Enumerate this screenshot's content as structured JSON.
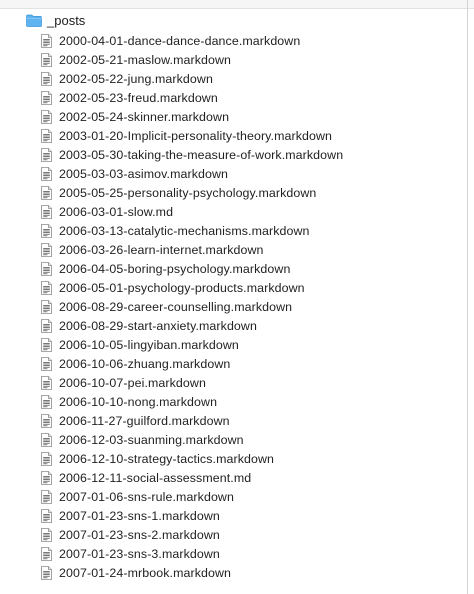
{
  "folder": {
    "name": "_posts",
    "icon": "folder-icon",
    "color": "#5fb3f0"
  },
  "files": [
    {
      "name": "2000-04-01-dance-dance-dance.markdown",
      "icon": "document-icon"
    },
    {
      "name": "2002-05-21-maslow.markdown",
      "icon": "document-icon"
    },
    {
      "name": "2002-05-22-jung.markdown",
      "icon": "document-icon"
    },
    {
      "name": "2002-05-23-freud.markdown",
      "icon": "document-icon"
    },
    {
      "name": "2002-05-24-skinner.markdown",
      "icon": "document-icon"
    },
    {
      "name": "2003-01-20-Implicit-personality-theory.markdown",
      "icon": "document-icon"
    },
    {
      "name": "2003-05-30-taking-the-measure-of-work.markdown",
      "icon": "document-icon"
    },
    {
      "name": "2005-03-03-asimov.markdown",
      "icon": "document-icon"
    },
    {
      "name": "2005-05-25-personality-psychology.markdown",
      "icon": "document-icon"
    },
    {
      "name": "2006-03-01-slow.md",
      "icon": "document-icon"
    },
    {
      "name": "2006-03-13-catalytic-mechanisms.markdown",
      "icon": "document-icon"
    },
    {
      "name": "2006-03-26-learn-internet.markdown",
      "icon": "document-icon"
    },
    {
      "name": "2006-04-05-boring-psychology.markdown",
      "icon": "document-icon"
    },
    {
      "name": "2006-05-01-psychology-products.markdown",
      "icon": "document-icon"
    },
    {
      "name": "2006-08-29-career-counselling.markdown",
      "icon": "document-icon"
    },
    {
      "name": "2006-08-29-start-anxiety.markdown",
      "icon": "document-icon"
    },
    {
      "name": "2006-10-05-lingyiban.markdown",
      "icon": "document-icon"
    },
    {
      "name": "2006-10-06-zhuang.markdown",
      "icon": "document-icon"
    },
    {
      "name": "2006-10-07-pei.markdown",
      "icon": "document-icon"
    },
    {
      "name": "2006-10-10-nong.markdown",
      "icon": "document-icon"
    },
    {
      "name": "2006-11-27-guilford.markdown",
      "icon": "document-icon"
    },
    {
      "name": "2006-12-03-suanming.markdown",
      "icon": "document-icon"
    },
    {
      "name": "2006-12-10-strategy-tactics.markdown",
      "icon": "document-icon"
    },
    {
      "name": "2006-12-11-social-assessment.md",
      "icon": "document-icon"
    },
    {
      "name": "2007-01-06-sns-rule.markdown",
      "icon": "document-icon"
    },
    {
      "name": "2007-01-23-sns-1.markdown",
      "icon": "document-icon"
    },
    {
      "name": "2007-01-23-sns-2.markdown",
      "icon": "document-icon"
    },
    {
      "name": "2007-01-23-sns-3.markdown",
      "icon": "document-icon"
    },
    {
      "name": "2007-01-24-mrbook.markdown",
      "icon": "document-icon"
    }
  ]
}
